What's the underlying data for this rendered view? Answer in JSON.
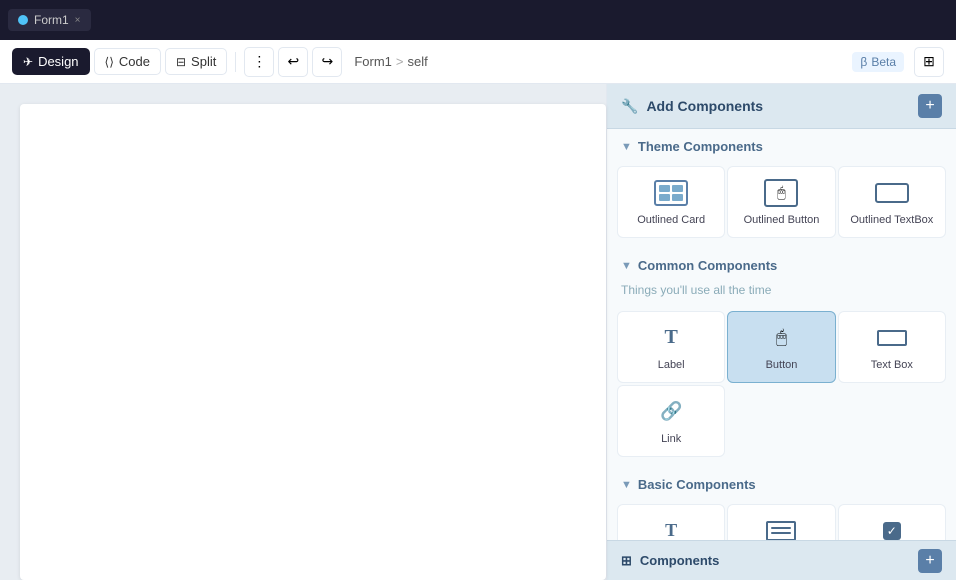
{
  "topbar": {
    "tab_label": "Form1",
    "tab_close": "×"
  },
  "toolbar": {
    "design_label": "Design",
    "code_label": "Code",
    "split_label": "Split",
    "breadcrumb_form": "Form1",
    "breadcrumb_arrow": ">",
    "breadcrumb_self": "self",
    "beta_label": "Beta"
  },
  "right_panel": {
    "header_title": "Add Components",
    "add_btn_label": "+",
    "sections": [
      {
        "id": "theme",
        "label": "Theme Components",
        "items": [
          {
            "id": "outlined-card",
            "label": "Outlined Card"
          },
          {
            "id": "outlined-button",
            "label": "Outlined Button"
          },
          {
            "id": "outlined-textbox",
            "label": "Outlined TextBox"
          }
        ]
      },
      {
        "id": "common",
        "label": "Common Components",
        "description": "Things you'll use all the time",
        "items": [
          {
            "id": "label",
            "label": "Label"
          },
          {
            "id": "button",
            "label": "Button",
            "selected": true
          },
          {
            "id": "text-box",
            "label": "Text Box"
          },
          {
            "id": "link",
            "label": "Link"
          }
        ]
      },
      {
        "id": "basic",
        "label": "Basic Components",
        "items": [
          {
            "id": "rich-text",
            "label": "Rich Text"
          },
          {
            "id": "text-area",
            "label": "Text Area"
          },
          {
            "id": "checkbox",
            "label": "Checkbox"
          }
        ]
      }
    ]
  },
  "bottom_panel": {
    "label": "Components",
    "add_label": "+"
  }
}
